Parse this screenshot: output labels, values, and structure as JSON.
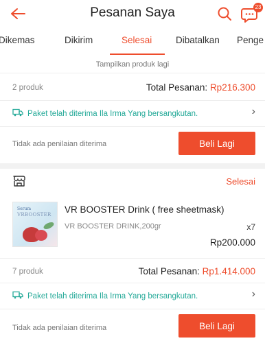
{
  "header": {
    "title": "Pesanan Saya",
    "chat_badge": "23",
    "accent_color": "#ee4d2d"
  },
  "tabs": [
    {
      "label": "Dikemas"
    },
    {
      "label": "Dikirim"
    },
    {
      "label": "Selesai",
      "active": true
    },
    {
      "label": "Dibatalkan"
    },
    {
      "label": "Penge"
    }
  ],
  "order1": {
    "show_more": "Tampilkan produk lagi",
    "count": "2 produk",
    "total_label": "Total Pesanan: ",
    "total_value": "Rp216.300",
    "shipping": "Paket telah diterima Ila Irma Yang bersangkutan.",
    "no_rating": "Tidak ada penilaian diterima",
    "buy_again": "Beli Lagi"
  },
  "order2": {
    "status": "Selesai",
    "product": {
      "name": "VR BOOSTER Drink ( free sheetmask)",
      "variant": "VR BOOSTER DRINK,200gr",
      "qty": "x7",
      "price": "Rp200.000",
      "thumb_text_1": "Serum",
      "thumb_text_2": "VRBOOSTER"
    },
    "count": "7 produk",
    "total_label": "Total Pesanan: ",
    "total_value": "Rp1.414.000",
    "shipping": "Paket telah diterima Ila Irma Yang bersangkutan.",
    "no_rating": "Tidak ada penilaian diterima",
    "buy_again": "Beli Lagi"
  }
}
